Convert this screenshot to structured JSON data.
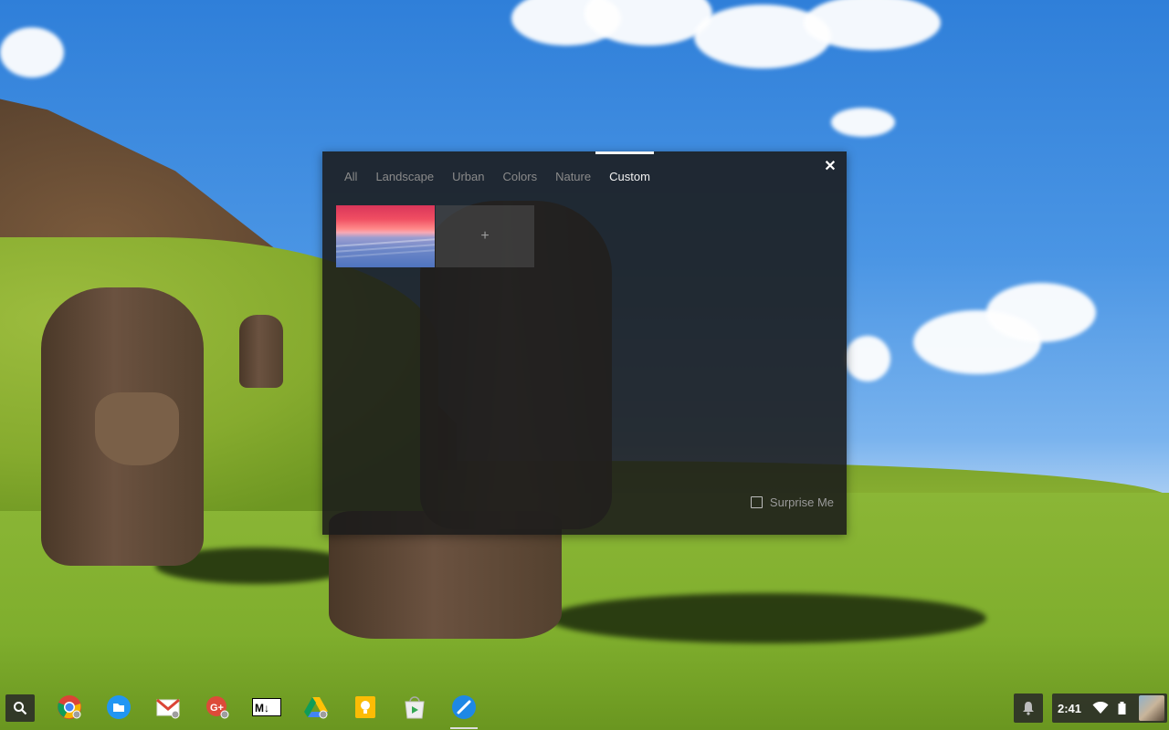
{
  "dialog": {
    "tabs": [
      {
        "label": "All"
      },
      {
        "label": "Landscape"
      },
      {
        "label": "Urban"
      },
      {
        "label": "Colors"
      },
      {
        "label": "Nature"
      },
      {
        "label": "Custom"
      }
    ],
    "active_tab": "Custom",
    "close_icon": "close-icon",
    "add_symbol": "+",
    "surprise_label": "Surprise Me",
    "surprise_checked": false
  },
  "shelf": {
    "apps": [
      {
        "name": "chrome-icon"
      },
      {
        "name": "files-icon"
      },
      {
        "name": "gmail-icon"
      },
      {
        "name": "google-plus-icon"
      },
      {
        "name": "markdown-icon"
      },
      {
        "name": "drive-icon"
      },
      {
        "name": "keep-icon"
      },
      {
        "name": "play-store-icon"
      },
      {
        "name": "paint-icon"
      }
    ],
    "clock": "2:41"
  },
  "colors": {
    "accent": "#f2f2f2",
    "dialog_bg": "#1a1a1a"
  }
}
